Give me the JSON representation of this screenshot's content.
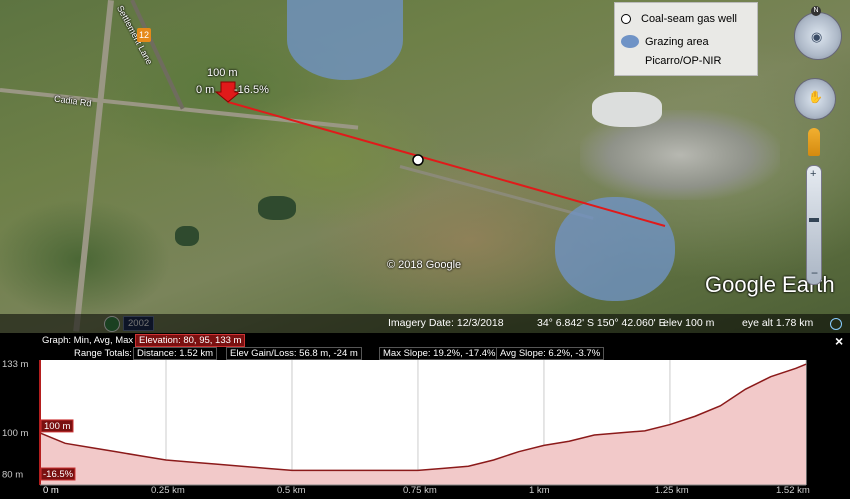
{
  "legend": {
    "items": [
      {
        "label": "Coal-seam gas well",
        "icon": "white-circle-icon"
      },
      {
        "label": "Grazing area",
        "icon": "blue-blob-icon"
      },
      {
        "label": "Picarro/OP-NIR",
        "icon": ""
      }
    ]
  },
  "map": {
    "copyright": "© 2018 Google",
    "brand": "Google Earth",
    "marker_top_label": "100 m",
    "marker_left_label": "0 m",
    "marker_right_label": "-16.5%",
    "road_label_1": "Cadia Rd",
    "road_label_2": "Settlement Lane",
    "road_shield": "12",
    "badge_year": "2002"
  },
  "statusbar": {
    "imagery_date": "Imagery Date: 12/3/2018",
    "coords": "34° 6.842' S   150° 42.060' E",
    "elev": "elev   100 m",
    "eye_alt": "eye alt   1.78 km"
  },
  "profile": {
    "graph_label": "Graph:  Min, Avg, Max",
    "elevation_box": "Elevation: 80, 95, 133 m",
    "range_totals": "Range Totals:",
    "distance": "Distance:  1.52 km",
    "elev_gain": "Elev Gain/Loss:  56.8 m, -24 m",
    "max_slope": "Max Slope:  19.2%, -17.4%",
    "avg_slope": "Avg Slope:  6.2%, -3.7%",
    "close": "×",
    "y_ticks": [
      "133 m",
      "100 m",
      "80 m"
    ],
    "x_ticks": [
      "0 m",
      "0.25 km",
      "0.5 km",
      "0.75 km",
      "1 km",
      "1.25 km",
      "1.52 km"
    ],
    "cursor_top": "100 m",
    "cursor_bottom": "-16.5%",
    "colors": {
      "fill": "#f2c9c9",
      "line": "#8b1a1a",
      "accent": "#b41e1e"
    }
  },
  "chart_data": {
    "type": "area",
    "x": [
      0,
      0.05,
      0.1,
      0.15,
      0.2,
      0.25,
      0.3,
      0.35,
      0.4,
      0.45,
      0.5,
      0.55,
      0.6,
      0.65,
      0.7,
      0.75,
      0.8,
      0.85,
      0.9,
      0.95,
      1.0,
      1.05,
      1.1,
      1.15,
      1.2,
      1.25,
      1.3,
      1.35,
      1.4,
      1.45,
      1.5,
      1.52
    ],
    "values": [
      100,
      95,
      93,
      91,
      89,
      87,
      86,
      85,
      84,
      83,
      82,
      82,
      82,
      82,
      82,
      82,
      83,
      84,
      87,
      91,
      94,
      96,
      99,
      100,
      101,
      104,
      108,
      113,
      121,
      127,
      131,
      133
    ],
    "xlabel": "",
    "ylabel": "",
    "ylim": [
      75,
      135
    ],
    "xlim": [
      0,
      1.52
    ]
  }
}
